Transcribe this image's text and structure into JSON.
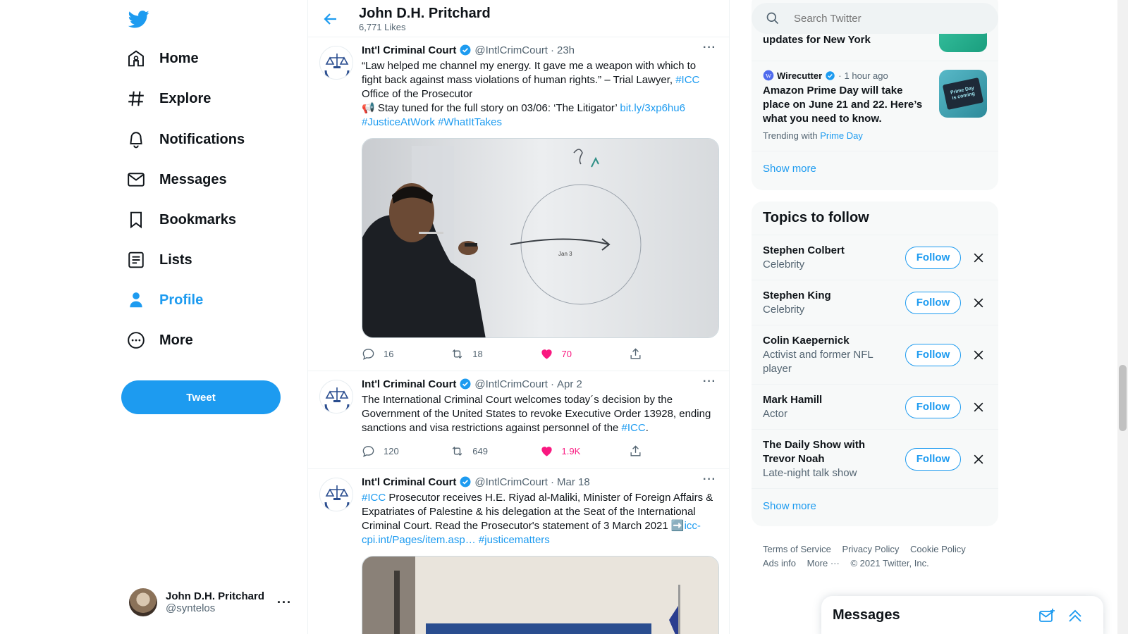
{
  "nav": {
    "items": [
      {
        "label": "Home",
        "icon": "home-icon"
      },
      {
        "label": "Explore",
        "icon": "hashtag-icon"
      },
      {
        "label": "Notifications",
        "icon": "bell-icon"
      },
      {
        "label": "Messages",
        "icon": "mail-icon"
      },
      {
        "label": "Bookmarks",
        "icon": "bookmark-icon"
      },
      {
        "label": "Lists",
        "icon": "list-icon"
      },
      {
        "label": "Profile",
        "icon": "person-icon"
      },
      {
        "label": "More",
        "icon": "more-circle-icon"
      }
    ],
    "tweet_label": "Tweet",
    "account": {
      "name": "John D.H. Pritchard",
      "handle": "@syntelos"
    },
    "brand_color": "#1d9bf0"
  },
  "header": {
    "title": "John D.H. Pritchard",
    "subtitle": "6,771 Likes"
  },
  "tweets": [
    {
      "name": "Int'l Criminal Court",
      "handle": "@IntlCrimCourt",
      "time": "23h",
      "text_1": "“Law helped me channel my energy. It gave me a weapon with which to fight back against mass violations of human rights.” – Trial Lawyer, ",
      "tag_1": "#ICC",
      "text_2": "\nOffice of the Prosecutor\n📢 Stay tuned for the full story on 03/06: ‘The Litigator’ ",
      "link_1": "bit.ly/3xp6hu6",
      "tags_2": "\n#JusticeAtWork #WhatItTakes",
      "replies": "16",
      "retweets": "18",
      "likes": "70"
    },
    {
      "name": "Int'l Criminal Court",
      "handle": "@IntlCrimCourt",
      "time": "Apr 2",
      "text_1": "The International Criminal Court welcomes today´s decision by the Government of the United States to revoke Executive Order 13928, ending sanctions and visa restrictions against personnel of the ",
      "tag_1": "#ICC",
      "text_2": ".",
      "replies": "120",
      "retweets": "649",
      "likes": "1.9K"
    },
    {
      "name": "Int'l Criminal Court",
      "handle": "@IntlCrimCourt",
      "time": "Mar 18",
      "tag_1": "#ICC",
      "text_1": " Prosecutor receives H.E. Riyad al-Maliki, Minister of Foreign Affairs & Expatriates of Palestine & his delegation at the Seat of the International Criminal Court. Read the Prosecutor's statement of 3 March 2021 ➡️",
      "link_1": "icc-cpi.int/Pages/item.asp…",
      "tag_2": "#justicematters"
    }
  ],
  "search": {
    "placeholder": "Search Twitter"
  },
  "trends": [
    {
      "headline": "updates for New York"
    },
    {
      "source": "Wirecutter",
      "time": "1 hour ago",
      "headline": "Amazon Prime Day will take place on June 21 and 22. Here’s what you need to know.",
      "trending_prefix": "Trending with",
      "trending_tag": "Prime Day",
      "img_text": "Prime Day is coming"
    }
  ],
  "show_more": "Show more",
  "topics": {
    "title": "Topics to follow",
    "follow_label": "Follow",
    "items": [
      {
        "name": "Stephen Colbert",
        "category": "Celebrity"
      },
      {
        "name": "Stephen King",
        "category": "Celebrity"
      },
      {
        "name": "Colin Kaepernick",
        "category": "Activist and former NFL player"
      },
      {
        "name": "Mark Hamill",
        "category": "Actor"
      },
      {
        "name": "The Daily Show with Trevor Noah",
        "category": "Late-night talk show"
      }
    ]
  },
  "footer": {
    "links": [
      "Terms of Service",
      "Privacy Policy",
      "Cookie Policy",
      "Ads info",
      "More ···"
    ],
    "copyright": "© 2021 Twitter, Inc."
  },
  "messages_drawer": {
    "title": "Messages"
  }
}
